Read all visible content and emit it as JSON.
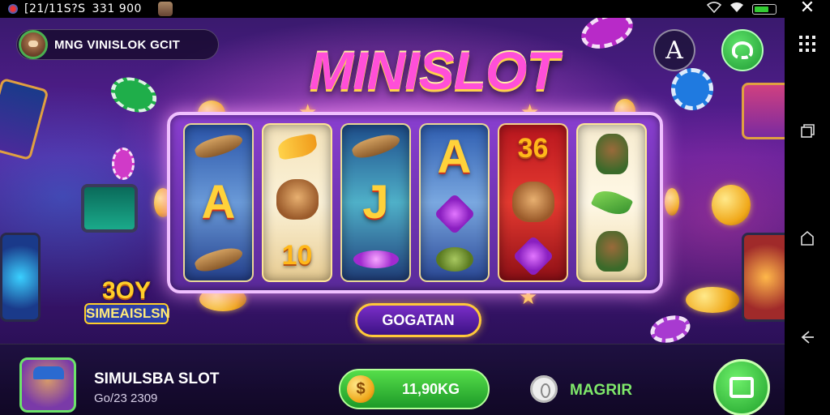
{
  "status_bar": {
    "carrier_text": "[21/11S?S",
    "number_text": "331 900"
  },
  "header": {
    "profile_name": "MNG VINISLOK GCIT"
  },
  "game": {
    "title": "MINISLOT",
    "spin_label": "GOGATAN",
    "logo_top": "3OY",
    "logo_bottom": "SIMEAISLSN",
    "reels": [
      [
        {
          "kind": "pic",
          "pic": "pic-hotdog"
        },
        {
          "kind": "letter",
          "text": "A"
        },
        {
          "kind": "pic",
          "pic": "pic-hotdog"
        }
      ],
      [
        {
          "kind": "pic",
          "pic": "pic-fish"
        },
        {
          "kind": "pic",
          "pic": "pic-animal"
        },
        {
          "kind": "num",
          "text": "10"
        }
      ],
      [
        {
          "kind": "pic",
          "pic": "pic-hotdog"
        },
        {
          "kind": "letter",
          "text": "J"
        },
        {
          "kind": "pic",
          "pic": "pic-chip"
        }
      ],
      [
        {
          "kind": "letter",
          "text": "A"
        },
        {
          "kind": "pic",
          "pic": "pic-gem"
        },
        {
          "kind": "pic",
          "pic": "pic-turtle"
        }
      ],
      [
        {
          "kind": "num",
          "text": "36"
        },
        {
          "kind": "pic",
          "pic": "pic-animal"
        },
        {
          "kind": "pic",
          "pic": "pic-gem"
        }
      ],
      [
        {
          "kind": "pic",
          "pic": "pic-char"
        },
        {
          "kind": "pic",
          "pic": "pic-leaf"
        },
        {
          "kind": "pic",
          "pic": "pic-char"
        }
      ]
    ]
  },
  "bottom_bar": {
    "player_name": "SIMULSBA SLOT",
    "player_sub": "Go/23 2309",
    "balance_currency_symbol": "$",
    "balance_amount": "11,90KG",
    "magrir_label": "MAGRIR"
  },
  "colors": {
    "accent_green": "#2fbf3c",
    "title_pink": "#ff4fd8",
    "gold": "#ffc83a"
  }
}
